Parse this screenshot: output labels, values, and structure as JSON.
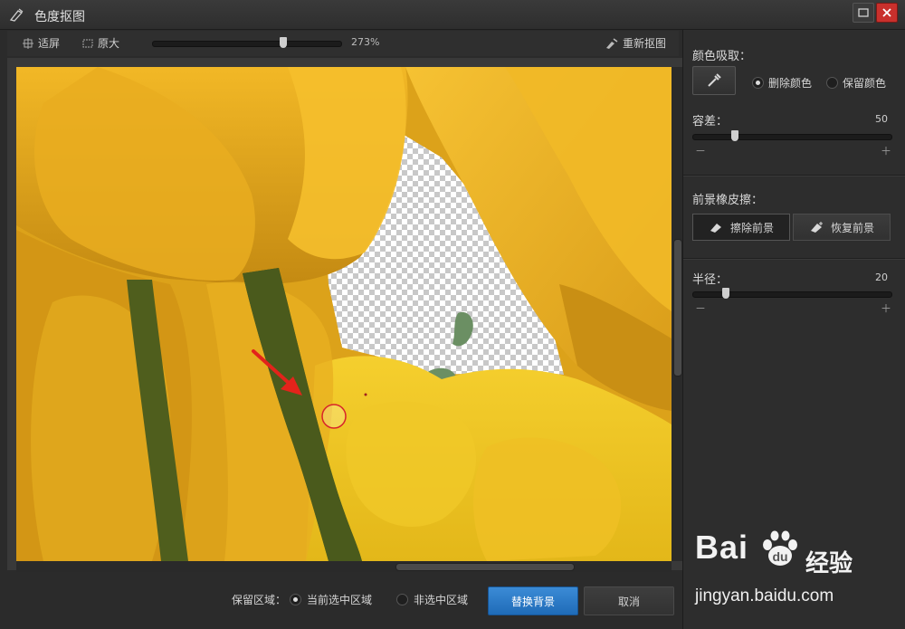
{
  "window": {
    "title": "色度抠图"
  },
  "toolbar": {
    "fit_label": "适屏",
    "original_label": "原大",
    "zoom_value": "273%",
    "zoom_fraction": 0.7,
    "reset_label": "重新抠图"
  },
  "panel": {
    "color_pick_label": "颜色吸取：",
    "delete_color_label": "删除颜色",
    "keep_color_label": "保留颜色",
    "tolerance_label": "容差：",
    "tolerance_value": "50",
    "tolerance_fraction": 0.2,
    "eraser_label": "前景橡皮擦：",
    "erase_fg_label": "擦除前景",
    "restore_fg_label": "恢复前景",
    "radius_label": "半径：",
    "radius_value": "20",
    "radius_fraction": 0.15,
    "minus": "－",
    "plus": "＋"
  },
  "bottom": {
    "keep_area_label": "保留区域：",
    "current_sel_label": "当前选中区域",
    "non_sel_label": "非选中区域",
    "replace_bg_label": "替换背景",
    "cancel_label": "取消"
  },
  "watermark": {
    "brand": "Bai",
    "brand_suffix": "经验",
    "url": "jingyan.baidu.com"
  },
  "colors": {
    "accent": "#2a7bd0",
    "close": "#c9302c",
    "tulip": "#e6b01e",
    "stem": "#4b5a1c"
  }
}
